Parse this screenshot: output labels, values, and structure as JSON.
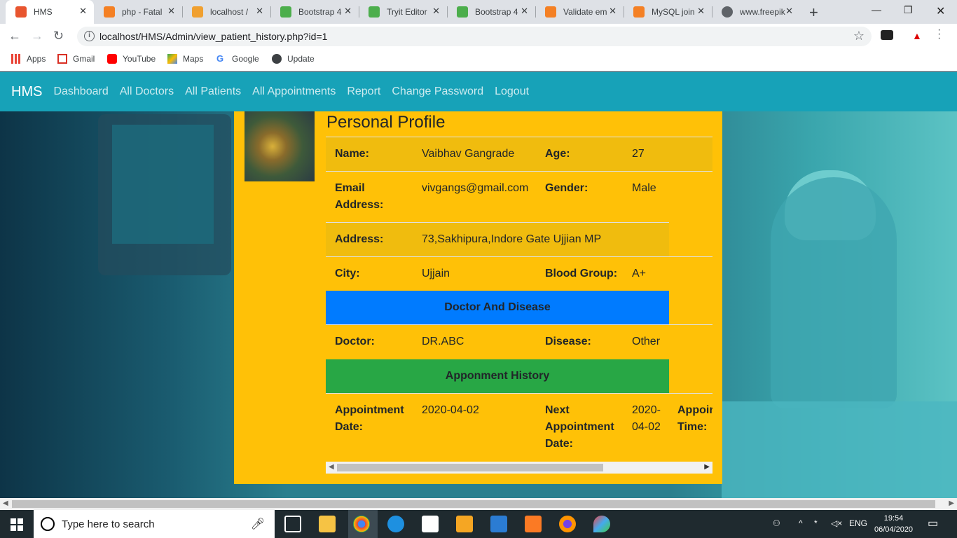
{
  "browser": {
    "tabs": [
      {
        "title": "HMS",
        "active": true,
        "icon_color": "#e8552f"
      },
      {
        "title": "php - Fatal",
        "active": false,
        "icon_color": "#f48024"
      },
      {
        "title": "localhost /",
        "active": false,
        "icon_color": "#f0a030"
      },
      {
        "title": "Bootstrap 4",
        "active": false,
        "icon_color": "#4cae4c"
      },
      {
        "title": "Tryit Editor",
        "active": false,
        "icon_color": "#4cae4c"
      },
      {
        "title": "Bootstrap 4",
        "active": false,
        "icon_color": "#4cae4c"
      },
      {
        "title": "Validate em",
        "active": false,
        "icon_color": "#f48024"
      },
      {
        "title": "MySQL join",
        "active": false,
        "icon_color": "#f48024"
      },
      {
        "title": "www.freepik",
        "active": false,
        "icon_color": "#5f6368"
      }
    ],
    "url": "localhost/HMS/Admin/view_patient_history.php?id=1",
    "bookmarks": [
      {
        "label": "Apps",
        "icon": "apps-grid-icon"
      },
      {
        "label": "Gmail",
        "icon": "gmail-icon"
      },
      {
        "label": "YouTube",
        "icon": "youtube-icon"
      },
      {
        "label": "Maps",
        "icon": "maps-icon"
      },
      {
        "label": "Google",
        "icon": "google-icon"
      },
      {
        "label": "Update",
        "icon": "globe-icon"
      }
    ]
  },
  "navbar": {
    "brand": "HMS",
    "links": [
      "Dashboard",
      "All Doctors",
      "All Patients",
      "All Appointments",
      "Report",
      "Change Password",
      "Logout"
    ],
    "color": "#17a2b8"
  },
  "profile": {
    "title": "Personal Profile",
    "name_label": "Name:",
    "name": "Vaibhav Gangrade",
    "age_label": "Age:",
    "age": "27",
    "email_label_1": "Email",
    "email_label_2": "Address:",
    "email": "vivgangs@gmail.com",
    "gender_label": "Gender:",
    "gender": "Male",
    "address_label": "Address:",
    "address": "73,Sakhipura,Indore Gate Ujjian MP",
    "city_label": "City:",
    "city": "Ujjain",
    "blood_label": "Blood Group:",
    "blood": "A+",
    "section_doctor": "Doctor And Disease",
    "doctor_label": "Doctor:",
    "doctor": "DR.ABC",
    "disease_label": "Disease:",
    "disease": "Other",
    "section_history": "Apponment History",
    "appt_date_label_1": "Appointment",
    "appt_date_label_2": "Date:",
    "appt_date": "2020-04-02",
    "next_label_1": "Next",
    "next_label_2": "Appointment",
    "next_label_3": "Date:",
    "next_date_1": "2020-",
    "next_date_2": "04-02",
    "appt_time_label_1": "Appoir",
    "appt_time_label_2": "Time:",
    "card_color": "#ffc107",
    "blue": "#007bff",
    "green": "#28a745"
  },
  "taskbar": {
    "search_placeholder": "Type here to search",
    "lang": "ENG",
    "time": "19:54",
    "date": "06/04/2020"
  }
}
